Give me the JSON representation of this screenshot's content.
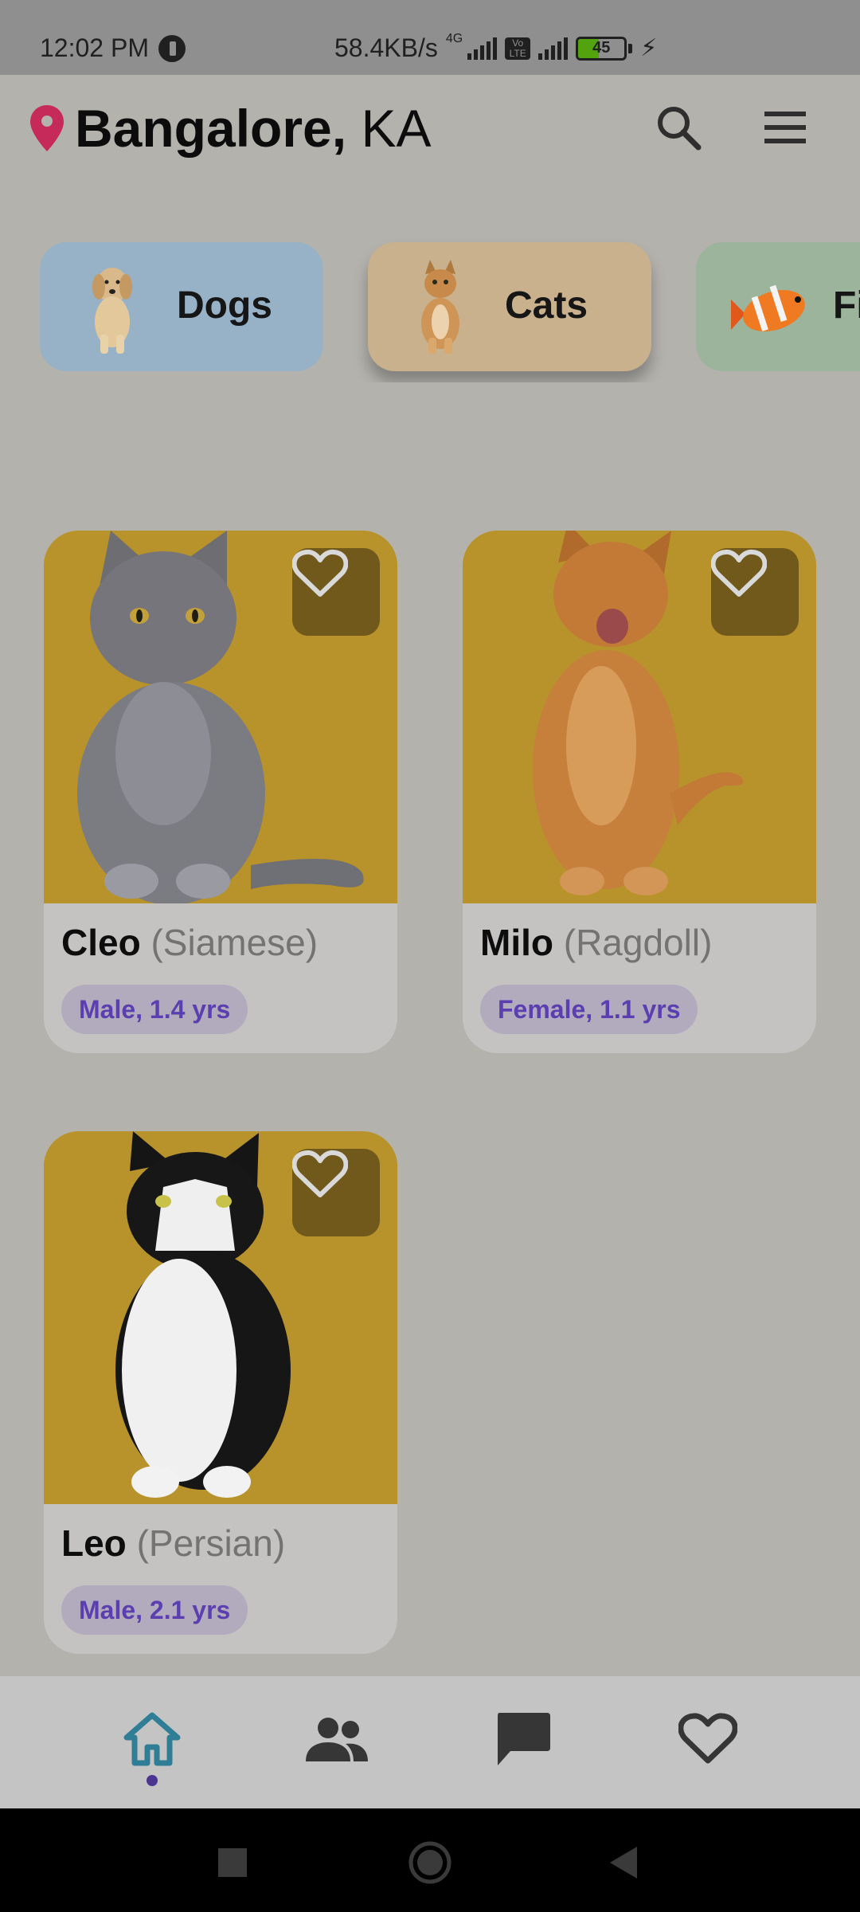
{
  "status_bar": {
    "time": "12:02 PM",
    "net_speed": "58.4KB/s",
    "network_tag": "4G",
    "volte_line1": "Vo",
    "volte_line2": "LTE",
    "battery_level": "45",
    "battery_fill_percent": 45,
    "battery_color": "#53a30f"
  },
  "header": {
    "city": "Bangalore,",
    "state": "KA",
    "pin_color": "#c62a5a"
  },
  "categories": [
    {
      "label": "Dogs",
      "color": "#97b2c7",
      "selected": false
    },
    {
      "label": "Cats",
      "color": "#c8b18c",
      "selected": true
    },
    {
      "label": "Fish",
      "color": "#9cb39c",
      "selected": false
    }
  ],
  "pets": [
    {
      "name": "Cleo",
      "breed": "(Siamese)",
      "info": "Male, 1.4 yrs"
    },
    {
      "name": "Milo",
      "breed": "(Ragdoll)",
      "info": "Female, 1.1 yrs"
    },
    {
      "name": "Leo",
      "breed": "(Persian)",
      "info": "Male, 2.1 yrs"
    }
  ],
  "bottom_nav": {
    "active_index": 0,
    "items": [
      "home-icon",
      "people-icon",
      "chat-icon",
      "heart-icon"
    ],
    "active_color": "#2f7e95",
    "inactive_color": "#363636"
  },
  "colors": {
    "chip_text": "#5b3fb0",
    "chip_bg": "#b1abbd",
    "card_photo_bg": "#b8922a"
  }
}
